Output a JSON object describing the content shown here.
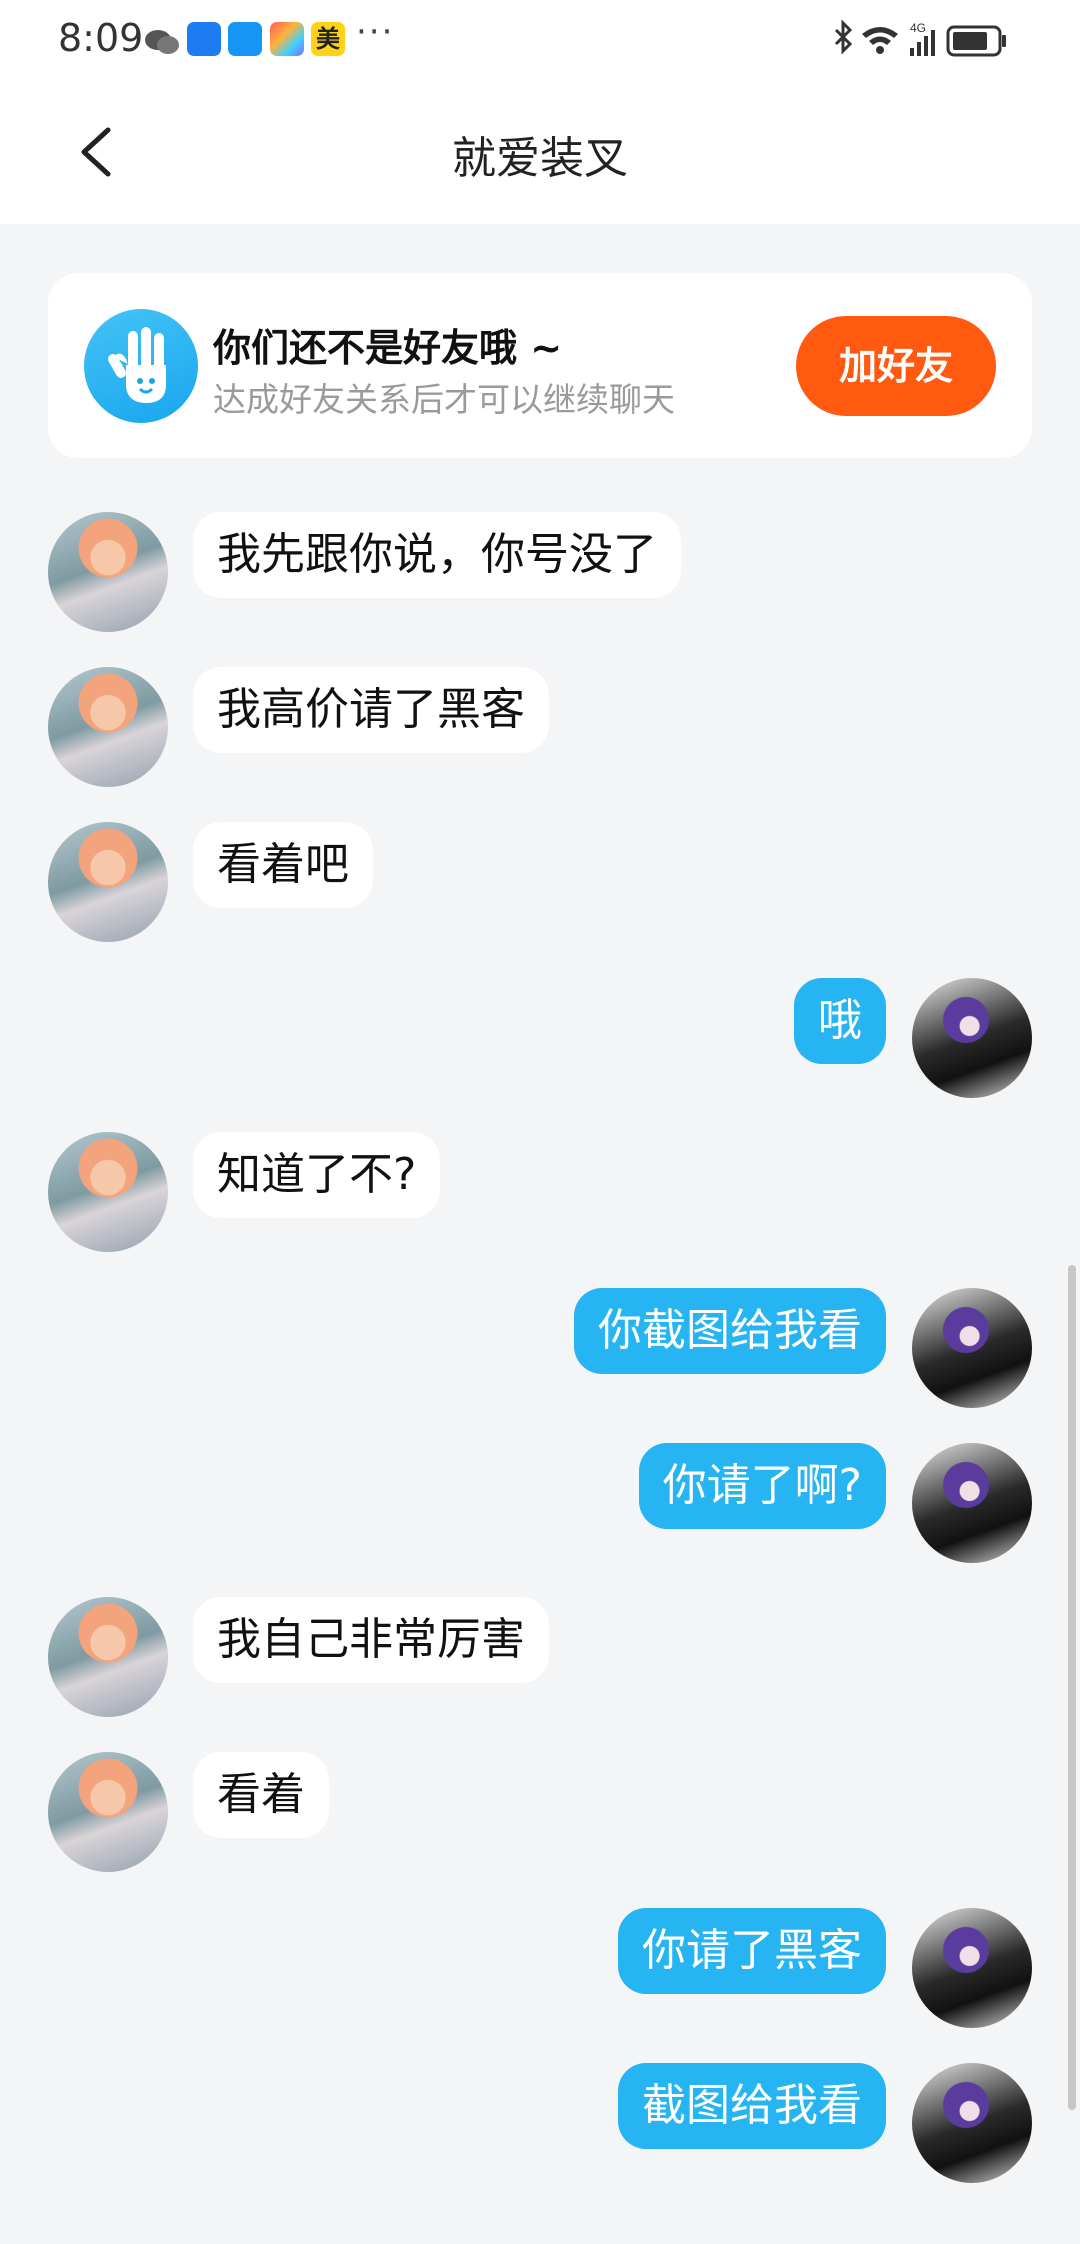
{
  "status_bar": {
    "time": "8:09",
    "dots": "···",
    "mei_label": "美"
  },
  "header": {
    "title": "就爱装叉"
  },
  "banner": {
    "title": "你们还不是好友哦 ~",
    "subtitle": "达成好友关系后才可以继续聊天",
    "add_button": "加好友"
  },
  "messages": [
    {
      "side": "left",
      "text": "我先跟你说，你号没了"
    },
    {
      "side": "left",
      "text": "我高价请了黑客"
    },
    {
      "side": "left",
      "text": "看着吧"
    },
    {
      "side": "right",
      "text": "哦"
    },
    {
      "side": "left",
      "text": "知道了不?"
    },
    {
      "side": "right",
      "text": "你截图给我看"
    },
    {
      "side": "right",
      "text": "你请了啊?"
    },
    {
      "side": "left",
      "text": "我自己非常厉害"
    },
    {
      "side": "left",
      "text": "看着"
    },
    {
      "side": "right",
      "text": "你请了黑客"
    },
    {
      "side": "right",
      "text": "截图给我看"
    }
  ],
  "colors": {
    "accent": "#26b4f3",
    "add_button": "#ff5a10",
    "background": "#f4f5f7"
  }
}
